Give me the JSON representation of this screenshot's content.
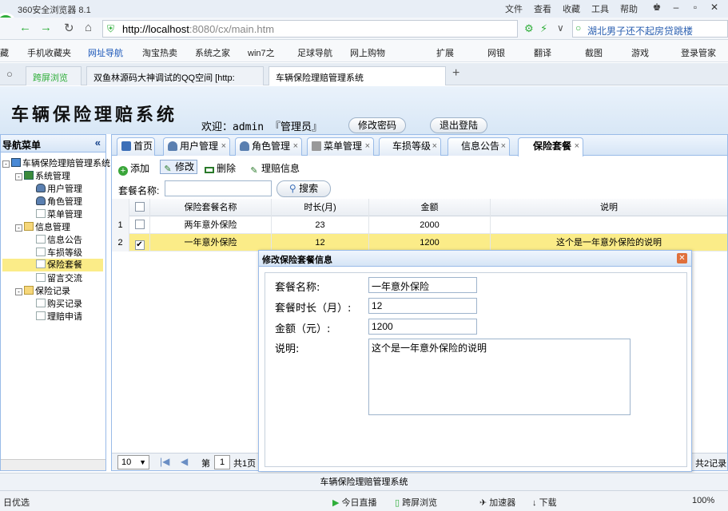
{
  "browser": {
    "title": "360安全浏览器 8.1",
    "menus": [
      "文件",
      "查看",
      "收藏",
      "工具",
      "帮助"
    ],
    "url_host": "http://localhost",
    "url_rest": ":8080/cx/main.htm",
    "search_text": "湖北男子还不起房贷跳楼",
    "bookmarks": [
      "藏",
      "手机收藏夹",
      "网址导航",
      "淘宝热卖",
      "系统之家",
      "win7之",
      "足球导航",
      "网上购物",
      "扩展",
      "网银",
      "翻译",
      "截图",
      "游戏",
      "登录管家"
    ],
    "tabs": [
      "跨屏浏览",
      "双鱼林源码大神调试的QQ空间 [http:",
      "车辆保险理赔管理系统"
    ],
    "status": [
      "日优选",
      "今日直播",
      "跨屏浏览",
      "加速器",
      "下载",
      "100%"
    ]
  },
  "app": {
    "title": "车辆保险理赔系统",
    "welcome": "欢迎：admin 『管理员』",
    "change_password": "修改密码",
    "logout": "退出登陆",
    "footer": "车辆保险理赔管理系统"
  },
  "sidebar": {
    "title": "导航菜单",
    "collapse": "«",
    "root": "车辆保险理赔管理系统",
    "groups": [
      {
        "label": "系统管理",
        "items": [
          "用户管理",
          "角色管理",
          "菜单管理"
        ]
      },
      {
        "label": "信息管理",
        "items": [
          "信息公告",
          "车损等级",
          "保险套餐",
          "留言交流"
        ]
      },
      {
        "label": "保险记录",
        "items": [
          "购买记录",
          "理赔申请"
        ]
      }
    ]
  },
  "tabs": [
    "首页",
    "用户管理",
    "角色管理",
    "菜单管理",
    "车损等级",
    "信息公告",
    "保险套餐"
  ],
  "toolbar": {
    "add": "添加",
    "edit": "修改",
    "delete": "删除",
    "claim": "理赔信息"
  },
  "search": {
    "label": "套餐名称:",
    "value": "",
    "button": "搜索"
  },
  "grid": {
    "columns": [
      "保险套餐名称",
      "时长(月)",
      "金额",
      "说明"
    ],
    "rows": [
      {
        "n": "1",
        "name": "两年意外保险",
        "months": "23",
        "amount": "2000",
        "desc": "",
        "checked": false,
        "selected": false
      },
      {
        "n": "2",
        "name": "一年意外保险",
        "months": "12",
        "amount": "1200",
        "desc": "这个是一年意外保险的说明",
        "checked": true,
        "selected": true
      }
    ]
  },
  "pager": {
    "page_size": "10",
    "page_prefix": "第",
    "page": "1",
    "page_total": "共1页",
    "records": "共2记录"
  },
  "dialog": {
    "title": "修改保险套餐信息",
    "fields": [
      {
        "label": "套餐名称:",
        "value": "一年意外保险"
      },
      {
        "label": "套餐时长（月）:",
        "value": "12"
      },
      {
        "label": "金额（元）:",
        "value": "1200"
      },
      {
        "label": "说明:",
        "value": "这个是一年意外保险的说明"
      }
    ]
  },
  "colors": {
    "accent": "#99bbe8",
    "selected_row": "#fbec88",
    "browser_green": "#2fae3a"
  }
}
